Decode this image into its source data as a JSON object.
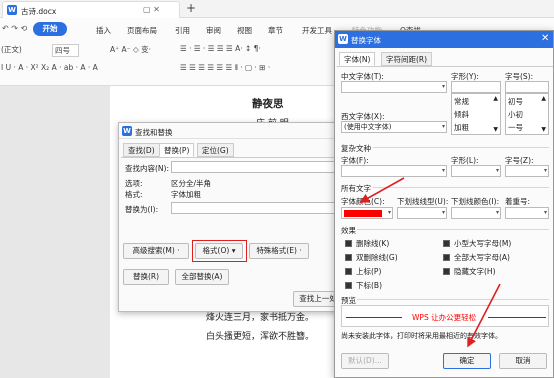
{
  "titlebar": {
    "app_icon": "W",
    "doc_tab": "古诗.docx",
    "tab_icons": "▢ ✕",
    "new_tab": "+"
  },
  "ribbon": {
    "undo": "↶ ↷ ⟲",
    "start": "开始",
    "menus": [
      "插入",
      "页面布局",
      "引用",
      "审阅",
      "视图",
      "章节",
      "开发工具",
      "特色功能",
      "Q查找"
    ],
    "font_name": "(正文)",
    "font_size": "四号",
    "row2": "A⁺ A⁻ ◇ 变·",
    "row3": "I U · A · X² X₂ A · ab · A · A",
    "para_row2": "☰ · ☰ · ☰ ☰ ☰ A· ↕ ¶·",
    "para_row3": "☰ ☰ ☰ ☰ ☰ ☰ ⫴ · ▢ · ⊞ ·"
  },
  "document": {
    "title": "静夜思",
    "line_partial": "床  前 明",
    "line1": "烽火连三月，家书抵万金。",
    "line2": "白头搔更短，浑欲不胜簪。"
  },
  "find_dialog": {
    "title": "查找和替换",
    "tabs": [
      "查找(D)",
      "替换(P)",
      "定位(G)"
    ],
    "find_label": "查找内容(N):",
    "option_label": "选项:",
    "option_value": "区分全/半角",
    "format_label": "格式:",
    "format_value": "字体加粗",
    "replace_label": "替换为(I):",
    "btn_advanced": "高级搜索(M) ·",
    "btn_format": "格式(O)",
    "btn_special": "特殊格式(E) ·",
    "btn_replace": "替换(R)",
    "btn_replace_all": "全部替换(A)",
    "btn_find_prev": "查找上一处"
  },
  "font_dialog": {
    "title": "替换字体",
    "tabs": [
      "字体(N)",
      "字符间距(R)"
    ],
    "cn_font_label": "中文字体(T):",
    "style_label": "字形(Y):",
    "size_label": "字号(S):",
    "west_font_label": "西文字体(X):",
    "west_font_value": "(使用中文字体)",
    "style_list": [
      "常规",
      "倾斜",
      "加粗"
    ],
    "size_list": [
      "初号",
      "小初",
      "一号"
    ],
    "complex_section": "复杂文种",
    "complex_font_label": "字体(F):",
    "complex_style_label": "字形(L):",
    "complex_size_label": "字号(Z):",
    "all_text_section": "所有文字",
    "color_label": "字体颜色(C):",
    "underline_label": "下划线线型(U):",
    "underline_color_label": "下划线颜色(I):",
    "emphasis_label": "着重号:",
    "effects_section": "效果",
    "effects_left": [
      "删除线(K)",
      "双删除线(G)",
      "上标(P)",
      "下标(B)"
    ],
    "effects_right": [
      "小型大写字母(M)",
      "全部大写字母(A)",
      "隐藏文字(H)"
    ],
    "preview_section": "预览",
    "preview_text": "WPS 让办公更轻松",
    "note": "尚未安装此字体，打印时将采用最相近的有效字体。",
    "btn_default": "默认(D)...",
    "btn_ok": "确定",
    "btn_cancel": "取消",
    "selected_color": "#ff0000",
    "accent": "#2b6fe0"
  }
}
